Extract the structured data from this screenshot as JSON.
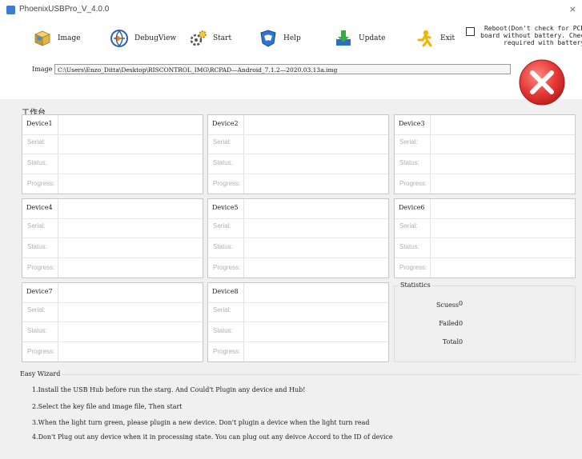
{
  "window": {
    "title": "PhoenixUSBPro_V_4.0.0",
    "close_glyph": "×"
  },
  "toolbar": {
    "image_label": "Image",
    "debugview_label": "DebugView",
    "start_label": "Start",
    "help_label": "Help",
    "update_label": "Update",
    "exit_label": "Exit"
  },
  "reboot": {
    "label": "Reboot(Don't check for PCBA board without battery. Check required with battery)",
    "checked": false
  },
  "image": {
    "label": "Image",
    "path": "C:\\Users\\Enzo_Ditta\\Desktop\\RISCONTROL_IMG\\RCPAD—Android_7.1.2—2020.03.13a.img"
  },
  "workbench": {
    "title": "工作台"
  },
  "field_labels": {
    "serial": "Serial:",
    "status": "Status:",
    "progress": "Progress:"
  },
  "devices": [
    {
      "name": "Device1"
    },
    {
      "name": "Device2"
    },
    {
      "name": "Device3"
    },
    {
      "name": "Device4"
    },
    {
      "name": "Device5"
    },
    {
      "name": "Device6"
    },
    {
      "name": "Device7"
    },
    {
      "name": "Device8"
    }
  ],
  "statistics": {
    "title": "Statistics",
    "success_label": "Scuess",
    "success_value": "0",
    "failed_label": "Failed",
    "failed_value": "0",
    "total_label": "Total",
    "total_value": "0"
  },
  "wizard": {
    "title": "Easy Wizard",
    "steps": [
      "1.Install the USB Hub before run the starg. And Could't Plugin any device and Hub!",
      "2.Select the key file and image file, Then start",
      "3.When the light turn green, please plugin a new device. Don't plugin a device when the light turn read",
      "4.Don't Plug out any device when it in processing state. You can plug out any deivce Accord to the ID of device"
    ]
  },
  "colors": {
    "status_light": "#e53935",
    "accent": "#3a7bd5"
  },
  "icons": {
    "image": "box-icon",
    "debugview": "globe-icon",
    "start": "gear-icon",
    "help": "shield-icon",
    "update": "download-icon",
    "exit": "person-icon",
    "status": "red-x-icon"
  }
}
